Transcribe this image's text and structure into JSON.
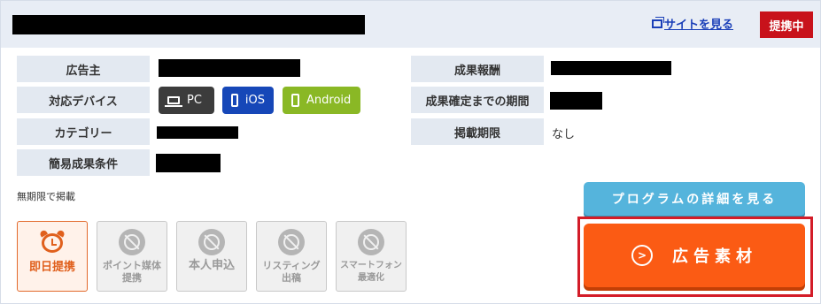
{
  "header": {
    "site_link_label": "サイトを見る",
    "status_badge": "提携中"
  },
  "info": {
    "advertiser_label": "広告主",
    "devices_label": "対応デバイス",
    "category_label": "カテゴリー",
    "simple_condition_label": "簡易成果条件",
    "reward_label": "成果報酬",
    "confirm_period_label": "成果確定までの期間",
    "listing_period_label": "掲載期限",
    "listing_period_value": "なし"
  },
  "devices": [
    {
      "label": "PC",
      "icon": "laptop-icon",
      "color": "#3c3c3c"
    },
    {
      "label": "iOS",
      "icon": "phone-icon",
      "color": "#1647b8"
    },
    {
      "label": "Android",
      "icon": "phone-icon",
      "color": "#8ab825"
    }
  ],
  "listing_note": "無期限で掲載",
  "features": [
    {
      "label": "即日提携",
      "icon": "alarm-clock-icon",
      "active": true
    },
    {
      "label_line1": "ポイント媒体",
      "label_line2": "提携",
      "icon": "prohibited-icon",
      "active": false
    },
    {
      "label": "本人申込",
      "icon": "prohibited-icon",
      "active": false
    },
    {
      "label_line1": "リスティング",
      "label_line2": "出稿",
      "icon": "prohibited-icon",
      "active": false
    },
    {
      "label_line1": "スマートフォン",
      "label_line2": "最適化",
      "icon": "prohibited-icon",
      "active": false
    }
  ],
  "buttons": {
    "program_detail": "プログラムの詳細を見る",
    "ad_material": "広告素材",
    "ad_material_icon": "circle-arrow-right-icon"
  },
  "colors": {
    "badge": "#c8121b",
    "detail_button": "#55b4dc",
    "ad_button": "#fb5b14",
    "highlight_frame": "#d31c28"
  }
}
